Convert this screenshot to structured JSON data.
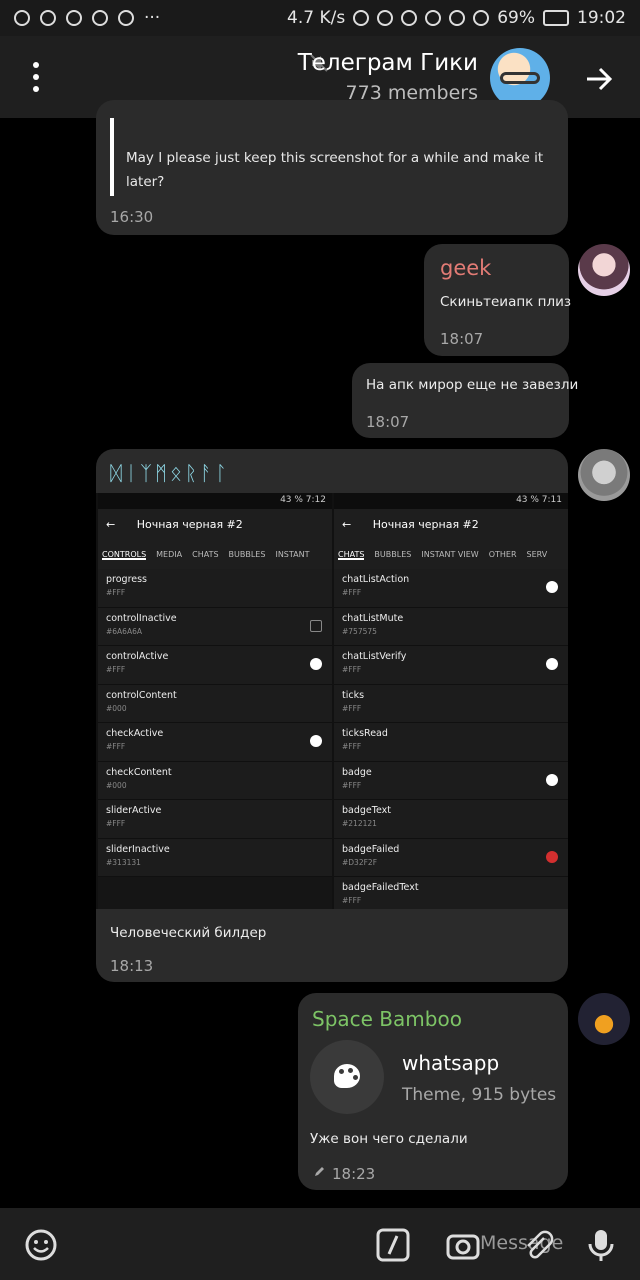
{
  "status_bar": {
    "speed": "4.7 K/s",
    "battery": "69%",
    "time": "19:02"
  },
  "header": {
    "title": "Телеграм Гики",
    "members": "773 members"
  },
  "messages": [
    {
      "quote_text": "May I please just keep this screenshot for a while and make it later?",
      "time": "16:30"
    },
    {
      "sender": "geek",
      "text": "Скиньтеиапк плиз",
      "time": "18:07"
    },
    {
      "text": "На апк мирор еще не завезли",
      "time": "18:07"
    },
    {
      "sender_runes": "ᛞᛁᛉᛗᛟᚱᚨᛚ",
      "caption": "Человеческий билдер",
      "time": "18:13",
      "screenshot": {
        "left": {
          "status": "43 % 7:12",
          "title": "Ночная черная #2",
          "tabs": [
            "CONTROLS",
            "MEDIA",
            "CHATS",
            "BUBBLES",
            "INSTANT"
          ],
          "rows": [
            {
              "name": "progress",
              "value": "#FFF"
            },
            {
              "name": "controlInactive",
              "value": "#6A6A6A"
            },
            {
              "name": "controlActive",
              "value": "#FFF"
            },
            {
              "name": "controlContent",
              "value": "#000"
            },
            {
              "name": "checkActive",
              "value": "#FFF"
            },
            {
              "name": "checkContent",
              "value": "#000"
            },
            {
              "name": "sliderActive",
              "value": "#FFF"
            },
            {
              "name": "sliderInactive",
              "value": "#313131"
            }
          ]
        },
        "right": {
          "status": "43 % 7:11",
          "title": "Ночная черная #2",
          "tabs": [
            "CHATS",
            "BUBBLES",
            "INSTANT VIEW",
            "OTHER",
            "SERV"
          ],
          "rows": [
            {
              "name": "chatListAction",
              "value": "#FFF"
            },
            {
              "name": "chatListMute",
              "value": "#757575"
            },
            {
              "name": "chatListVerify",
              "value": "#FFF"
            },
            {
              "name": "ticks",
              "value": "#FFF"
            },
            {
              "name": "ticksRead",
              "value": "#FFF"
            },
            {
              "name": "badge",
              "value": "#FFF"
            },
            {
              "name": "badgeText",
              "value": "#212121"
            },
            {
              "name": "badgeFailed",
              "value": "#D32F2F"
            },
            {
              "name": "badgeFailedText",
              "value": "#FFF"
            }
          ]
        }
      }
    },
    {
      "sender": "Space Bamboo",
      "file_name": "whatsapp",
      "file_meta": "Theme, 915 bytes",
      "text": "Уже вон чего сделали",
      "time": "18:23"
    }
  ],
  "input": {
    "placeholder": "Message"
  },
  "colors": {
    "bubble": "#2b2b2b",
    "geek_name": "#e27b75",
    "space_bamboo_name": "#7dc466",
    "rune_name": "#8fd8e6"
  }
}
